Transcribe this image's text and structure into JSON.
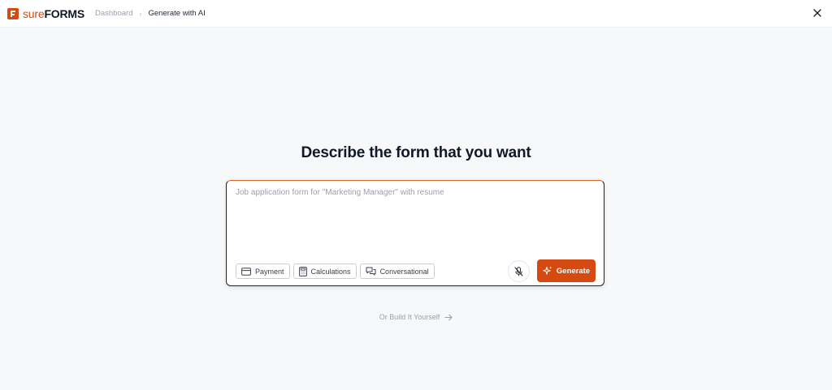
{
  "app": {
    "logo_sure": "sure",
    "logo_forms": "FORMS",
    "brand_color": "#d54a10"
  },
  "breadcrumb": {
    "parent": "Dashboard",
    "separator": "›",
    "current": "Generate with AI"
  },
  "header": {
    "close_icon": "close-icon"
  },
  "main": {
    "headline": "Describe the form that you want",
    "prompt_placeholder": "Job application form for \"Marketing Manager\" with resume",
    "prompt_value": "",
    "chips": [
      {
        "label": "Payment",
        "icon": "credit-card-icon"
      },
      {
        "label": "Calculations",
        "icon": "calculator-icon"
      },
      {
        "label": "Conversational",
        "icon": "chat-bubbles-icon"
      }
    ],
    "mic_icon": "microphone-off-icon",
    "generate_label": "Generate",
    "generate_icon": "sparkles-icon",
    "build_link": "Or Build It Yourself",
    "build_link_icon": "arrow-right-icon"
  }
}
